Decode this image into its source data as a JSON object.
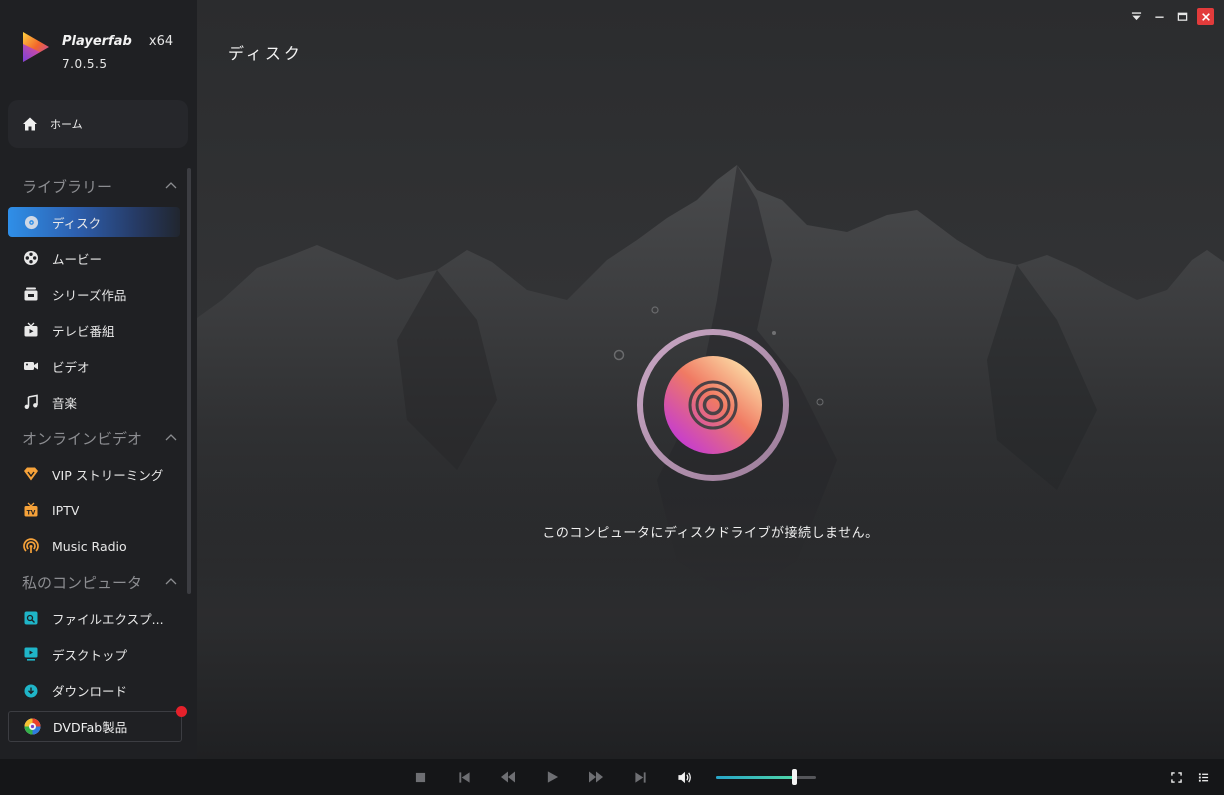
{
  "app": {
    "name": "Playerfab",
    "arch": "x64",
    "version": "7.0.5.5"
  },
  "sidebar": {
    "home_label": "ホーム",
    "sections": [
      {
        "title": "ライブラリー",
        "items": [
          {
            "label": "ディスク",
            "icon": "disc-icon",
            "active": true
          },
          {
            "label": "ムービー",
            "icon": "film-reel-icon"
          },
          {
            "label": "シリーズ作品",
            "icon": "series-icon"
          },
          {
            "label": "テレビ番組",
            "icon": "tv-icon"
          },
          {
            "label": "ビデオ",
            "icon": "video-camera-icon"
          },
          {
            "label": "音楽",
            "icon": "music-note-icon"
          }
        ]
      },
      {
        "title": "オンラインビデオ",
        "items": [
          {
            "label": "VIP ストリーミング",
            "icon": "vip-diamond-icon"
          },
          {
            "label": "IPTV",
            "icon": "iptv-icon"
          },
          {
            "label": "Music Radio",
            "icon": "radio-icon"
          }
        ]
      },
      {
        "title": "私のコンピュータ",
        "items": [
          {
            "label": "ファイルエクスプ...",
            "icon": "file-explorer-icon"
          },
          {
            "label": "デスクトップ",
            "icon": "desktop-icon"
          },
          {
            "label": "ダウンロード",
            "icon": "download-icon"
          }
        ]
      }
    ],
    "dvdfab_label": "DVDFab製品"
  },
  "main": {
    "title": "ディスク",
    "empty_message": "このコンピュータにディスクドライブが接続しません。"
  },
  "player": {
    "volume": 0.78
  },
  "colors": {
    "sidebar_bg": "#1f2023",
    "active_gradient_start": "#2f8fe8",
    "close_red": "#e23b3b",
    "accent_orange": "#f6a23a",
    "accent_teal": "#1fb5c8",
    "volume_teal": "#4fd6a8"
  }
}
